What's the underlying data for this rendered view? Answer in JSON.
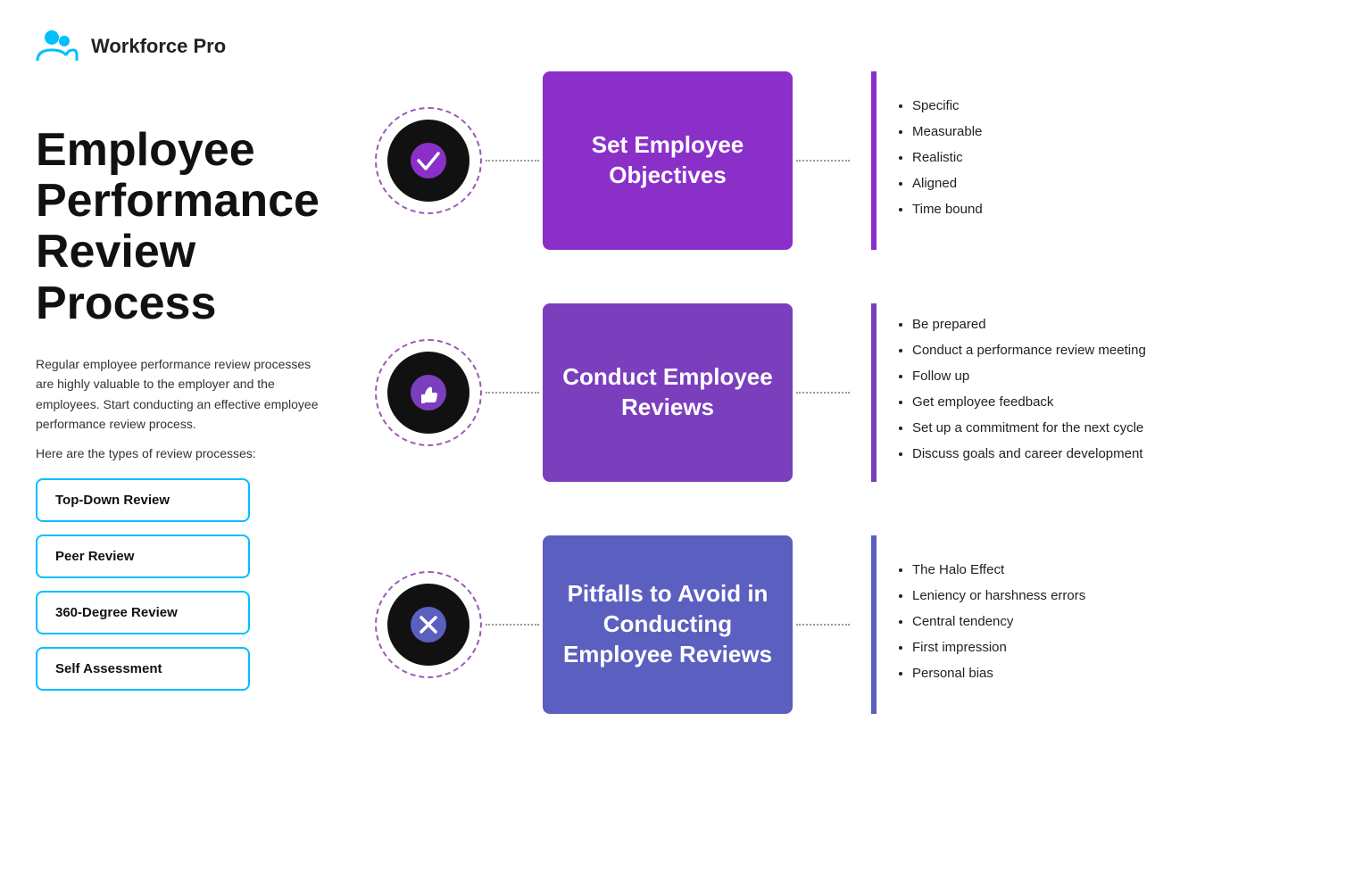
{
  "header": {
    "brand": "Workforce Pro"
  },
  "left": {
    "title": "Employee Performance Review Process",
    "description1": "Regular employee performance review processes are highly valuable to the employer and the employees. Start conducting an effective employee performance review process.",
    "description2": "Here are the types of review processes:",
    "buttons": [
      "Top-Down Review",
      "Peer Review",
      "360-Degree Review",
      "Self Assessment"
    ]
  },
  "rows": [
    {
      "id": "set-objectives",
      "icon": "checkmark",
      "box_label": "Set Employee Objectives",
      "box_color": "purple",
      "bullets": [
        "Specific",
        "Measurable",
        "Realistic",
        "Aligned",
        "Time bound"
      ]
    },
    {
      "id": "conduct-reviews",
      "icon": "thumbsup",
      "box_label": "Conduct Employee Reviews",
      "box_color": "medium-purple",
      "bullets": [
        "Be prepared",
        "Conduct a performance review meeting",
        "Follow up",
        "Get employee feedback",
        "Set up a commitment for the next cycle",
        "Discuss goals and career development"
      ]
    },
    {
      "id": "pitfalls",
      "icon": "cross",
      "box_label": "Pitfalls to Avoid in Conducting Employee Reviews",
      "box_color": "blue-purple",
      "bullets": [
        "The Halo Effect",
        "Leniency or harshness errors",
        "Central tendency",
        "First impression",
        "Personal bias"
      ]
    }
  ]
}
